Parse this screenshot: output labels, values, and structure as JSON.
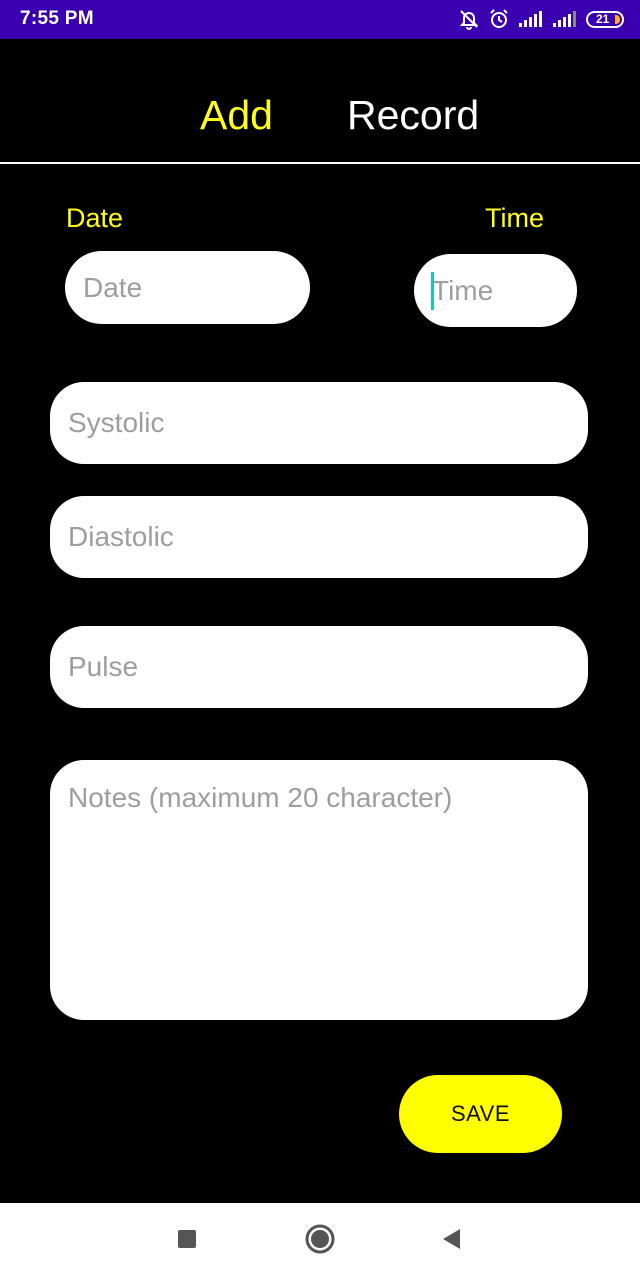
{
  "status_bar": {
    "time": "7:55 PM",
    "battery_level": "21",
    "icons": [
      "mute-notifications-icon",
      "alarm-icon",
      "signal-icon",
      "signal-icon",
      "battery-icon"
    ],
    "background_color": "#3a00b0"
  },
  "header": {
    "tabs": [
      {
        "label": "Add",
        "color": "#ffff1a",
        "active": true
      },
      {
        "label": "Record",
        "color": "#ffffff",
        "active": false
      }
    ]
  },
  "form": {
    "date_label": "Date",
    "time_label": "Time",
    "date_placeholder": "Date",
    "time_placeholder": "Time",
    "systolic_placeholder": "Systolic",
    "diastolic_placeholder": "Diastolic",
    "pulse_placeholder": "Pulse",
    "notes_placeholder": "Notes (maximum 20 character)",
    "label_color": "#ffff1a"
  },
  "actions": {
    "save_label": "SAVE",
    "save_color": "#ffff00"
  },
  "nav_bar": {
    "icons": [
      "recent-apps-icon",
      "home-icon",
      "back-icon"
    ]
  }
}
